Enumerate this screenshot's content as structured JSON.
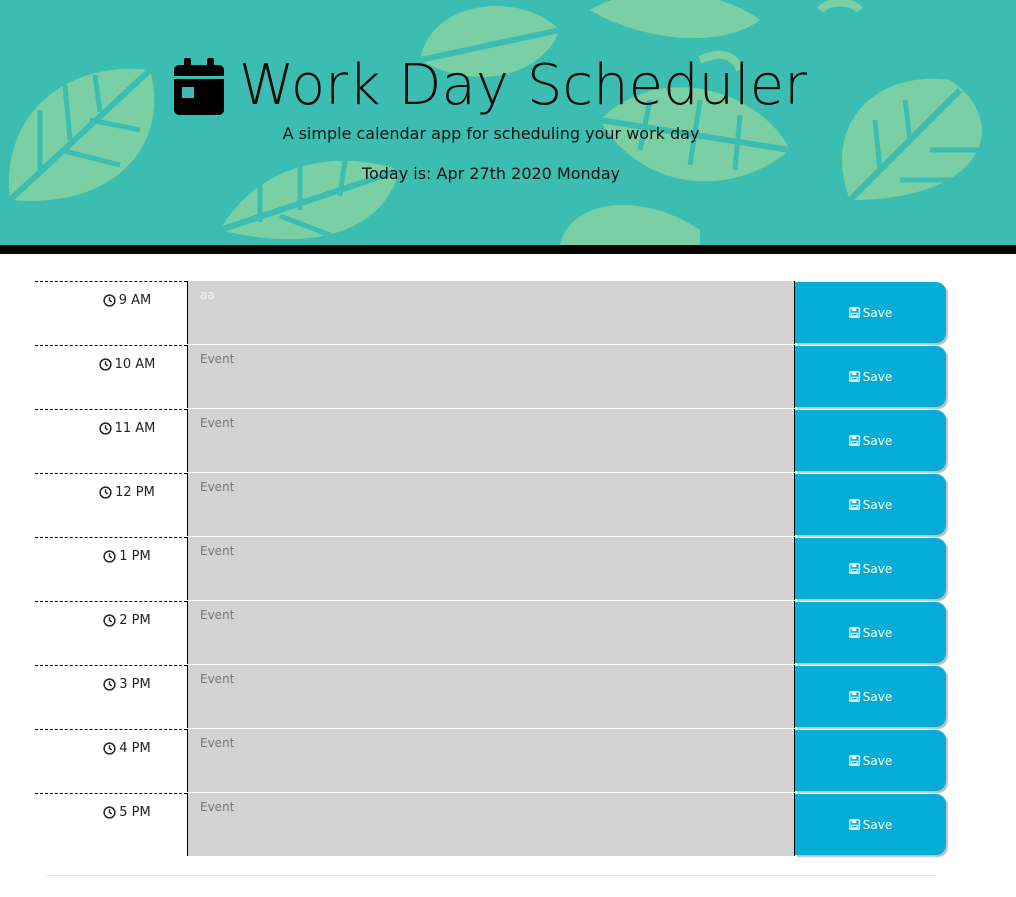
{
  "header": {
    "title": "Work Day Scheduler",
    "subtitle": "A simple calendar app for scheduling your work day",
    "today": "Today is: Apr 27th 2020 Monday",
    "calendar_icon": "calendar-icon",
    "background_color": "#3cbdb1",
    "leaf_color": "#7dd1a8"
  },
  "slots": [
    {
      "time": "9 AM",
      "event": "aa",
      "event_placeholder": "Event",
      "save_label": "Save"
    },
    {
      "time": "10 AM",
      "event": "",
      "event_placeholder": "Event",
      "save_label": "Save"
    },
    {
      "time": "11  AM",
      "event": "",
      "event_placeholder": "Event",
      "save_label": "Save"
    },
    {
      "time": "12  PM",
      "event": "",
      "event_placeholder": "Event",
      "save_label": "Save"
    },
    {
      "time": "1 PM",
      "event": "",
      "event_placeholder": "Event",
      "save_label": "Save"
    },
    {
      "time": "2  PM",
      "event": "",
      "event_placeholder": "Event",
      "save_label": "Save"
    },
    {
      "time": "3 PM",
      "event": "",
      "event_placeholder": "Event",
      "save_label": "Save"
    },
    {
      "time": "4 PM",
      "event": "",
      "event_placeholder": "Event",
      "save_label": "Save"
    },
    {
      "time": "5 PM",
      "event": "",
      "event_placeholder": "Event",
      "save_label": "Save"
    }
  ],
  "colors": {
    "event_background": "#d3d3d3",
    "save_button": "#06aed5",
    "header_bar": "#000000"
  }
}
